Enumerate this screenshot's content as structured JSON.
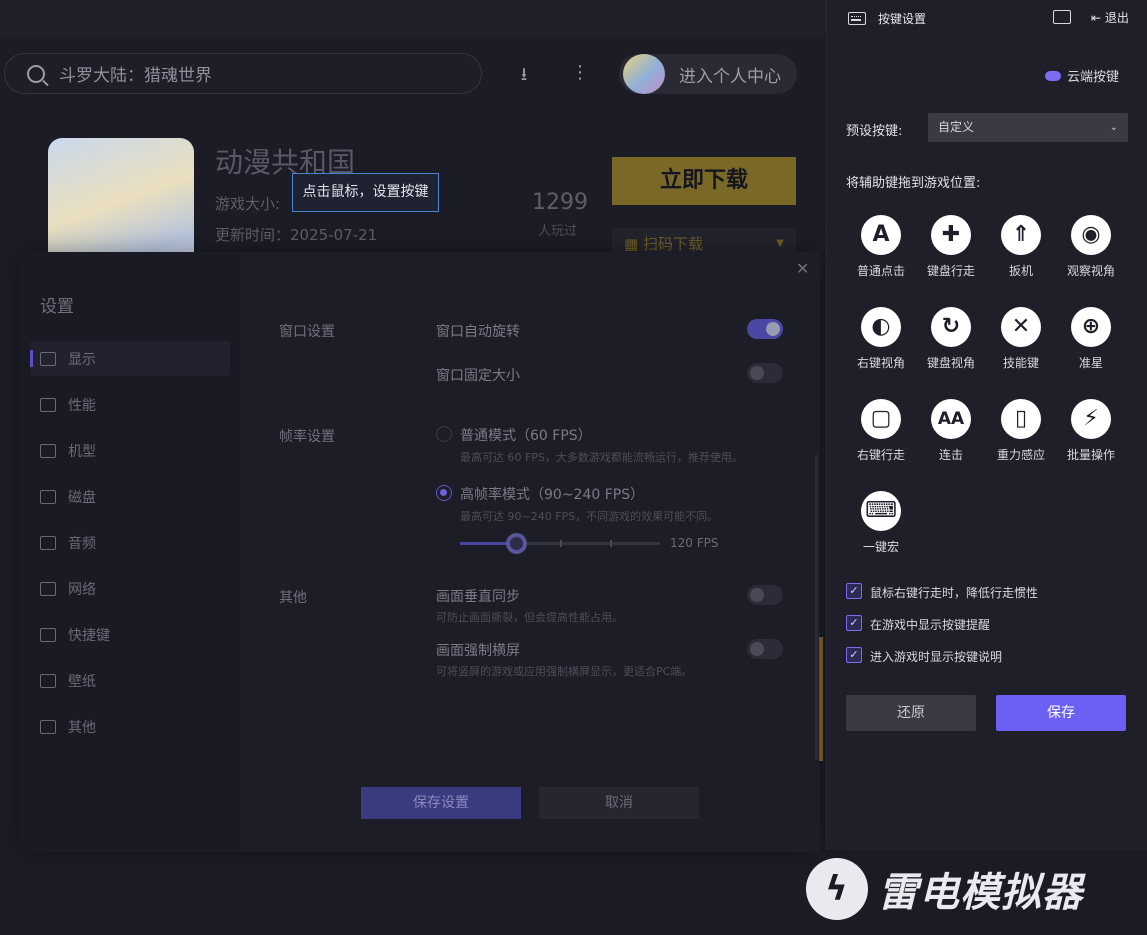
{
  "search": {
    "placeholder": "斗罗大陆：猎魂世界"
  },
  "header": {
    "download_icon": "download-icon",
    "more_icon": "more-vertical-icon",
    "user_center": "进入个人中心"
  },
  "game": {
    "title": "动漫共和国",
    "size_label": "游戏大小:",
    "update_label": "更新时间：2025-07-21",
    "players": "1299",
    "players_label": "人玩过",
    "download_btn": "立即下载",
    "qr_btn": "扫码下载"
  },
  "tooltip": "点击鼠标，设置按键",
  "settings": {
    "title": "设置",
    "nav": [
      {
        "label": "显示",
        "icon": "monitor-icon"
      },
      {
        "label": "性能",
        "icon": "pulse-icon"
      },
      {
        "label": "机型",
        "icon": "folder-icon"
      },
      {
        "label": "磁盘",
        "icon": "disk-icon"
      },
      {
        "label": "音频",
        "icon": "gamepad-icon"
      },
      {
        "label": "网络",
        "icon": "globe-icon"
      },
      {
        "label": "快捷键",
        "icon": "keyboard-icon"
      },
      {
        "label": "壁纸",
        "icon": "palette-icon"
      },
      {
        "label": "其他",
        "icon": "grid-icon"
      }
    ],
    "active": "显示",
    "window_section": "窗口设置",
    "auto_rotate": "窗口自动旋转",
    "auto_rotate_on": true,
    "fixed_size": "窗口固定大小",
    "fixed_size_on": false,
    "fps_section": "帧率设置",
    "normal_mode": "普通模式（60 FPS）",
    "normal_mode_desc": "最高可达 60 FPS，大多数游戏都能流畅运行，推荐使用。",
    "high_mode": "高帧率模式（90~240 FPS）",
    "high_mode_desc": "最高可达 90~240 FPS，不同游戏的效果可能不同。",
    "fps_value": "120 FPS",
    "fps_slider_fraction": 0.28,
    "other_section": "其他",
    "vsync": "画面垂直同步",
    "vsync_desc": "可防止画面撕裂，但会提高性能占用。",
    "force_landscape": "画面强制横屏",
    "force_landscape_desc": "可将竖屏的游戏或应用强制横屏显示，更适合PC端。",
    "save": "保存设置",
    "cancel": "取消"
  },
  "keymap": {
    "title": "按键设置",
    "exit": "退出",
    "cloud": "云端按键",
    "preset_label": "预设按键:",
    "preset_value": "自定义",
    "drag_hint": "将辅助键拖到游戏位置:",
    "keys": [
      {
        "label": "普通点击",
        "icon": "A"
      },
      {
        "label": "键盘行走",
        "icon": "✚"
      },
      {
        "label": "扳机",
        "icon": "⇑"
      },
      {
        "label": "观察视角",
        "icon": "◉"
      },
      {
        "label": "右键视角",
        "icon": "◐"
      },
      {
        "label": "键盘视角",
        "icon": "↻"
      },
      {
        "label": "技能键",
        "icon": "✕"
      },
      {
        "label": "准星",
        "icon": "⊕"
      },
      {
        "label": "右键行走",
        "icon": "▢"
      },
      {
        "label": "连击",
        "icon": "AA"
      },
      {
        "label": "重力感应",
        "icon": "▯"
      },
      {
        "label": "批量操作",
        "icon": "⚡"
      },
      {
        "label": "一键宏",
        "icon": "⌨"
      }
    ],
    "options": [
      "鼠标右键行走时，降低行走惯性",
      "在游戏中显示按键提醒",
      "进入游戏时显示按键说明"
    ],
    "restore": "还原",
    "save": "保存"
  },
  "logo": "雷电模拟器"
}
